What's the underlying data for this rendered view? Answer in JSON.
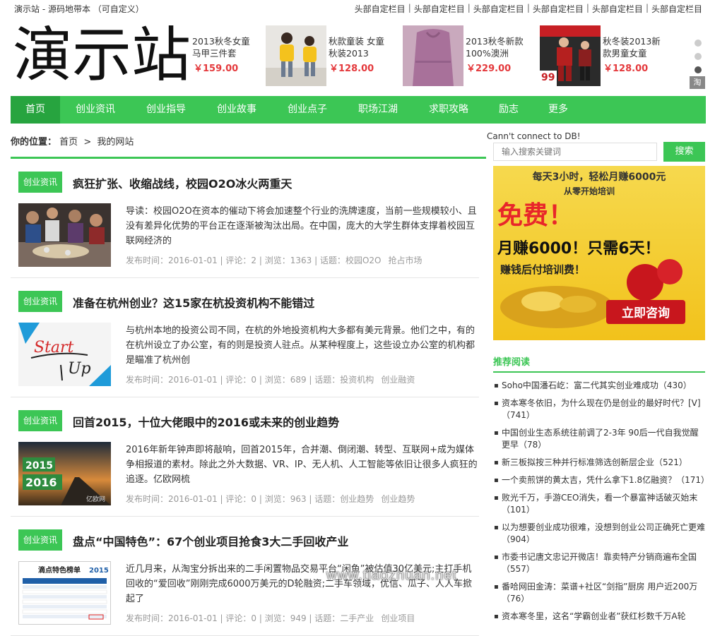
{
  "topbar": {
    "site_desc": "演示站 - 源码地带本 （可自定义）",
    "links": [
      "头部自定栏目",
      "头部自定栏目",
      "头部自定栏目",
      "头部自定栏目",
      "头部自定栏目",
      "头部自定栏目"
    ]
  },
  "logo": "演示站",
  "products": [
    {
      "title": "2013秋冬女童马甲三件套",
      "price": "￥159.00"
    },
    {
      "title": "秋款童装 女童 秋装2013",
      "price": "￥128.00"
    },
    {
      "title": "2013秋冬新款 100%澳洲",
      "price": "￥229.00"
    },
    {
      "title": "秋冬装2013新款男童女童",
      "price": "￥128.00"
    }
  ],
  "product_badge": "99",
  "taobao_badge": "淘",
  "nav": [
    "首页",
    "创业资讯",
    "创业指导",
    "创业故事",
    "创业点子",
    "职场江湖",
    "求职攻略",
    "励志",
    "更多"
  ],
  "breadcrumb": {
    "label": "你的位置：",
    "home": "首页",
    "sep": ">",
    "current": "我的网站"
  },
  "articles": [
    {
      "tag": "创业资讯",
      "title": "疯狂扩张、收缩战线，校园O2O冰火两重天",
      "summary": "导读：校园O2O在资本的催动下将会加速整个行业的洗牌速度，当前一些规模较小、且没有差异化优势的平台正在逐渐被淘汰出局。在中国，庞大的大学生群体支撑着校园互联网经济的",
      "meta": "发布时间：2016-01-01 | 评论：2 | 浏览：1363 | 话题：",
      "keywords": [
        "校园O2O",
        "抢占市场"
      ]
    },
    {
      "tag": "创业资讯",
      "title": "准备在杭州创业？这15家在杭投资机构不能错过",
      "summary": "与杭州本地的投资公司不同，在杭的外地投资机构大多都有美元背景。他们之中，有的在杭州设立了办公室，有的则是投资人驻点。从某种程度上，这些设立办公室的机构都是瞄准了杭州创",
      "meta": "发布时间：2016-01-01 | 评论：0 | 浏览：689 | 话题：",
      "keywords": [
        "投资机构",
        "创业融资"
      ],
      "thumb_text": [
        "Start",
        "Up"
      ]
    },
    {
      "tag": "创业资讯",
      "title": "回首2015，十位大佬眼中的2016或未来的创业趋势",
      "summary": "2016年新年钟声即将敲响，回首2015年，合并潮、倒闭潮、转型、互联网+成为媒体争相报道的素材。除此之外大数据、VR、IP、无人机、人工智能等依旧让很多人疯狂的追逐。亿欧网梳",
      "meta": "发布时间：2016-01-01 | 评论：0 | 浏览：963 | 话题：",
      "keywords": [
        "创业趋势",
        "创业趋势"
      ],
      "thumb_text": [
        "2015",
        "2016",
        "亿欧网"
      ]
    },
    {
      "tag": "创业资讯",
      "title": "盘点“中国特色”：67个创业项目抢食3大二手回收产业",
      "summary": "近几月来，从淘宝分拆出来的二手闲置物品交易平台“闲鱼”被估值30亿美元;主打手机回收的“爱回收”刚刚完成6000万美元的D轮融资;二手车领域，优信、瓜子、人人车掀起了",
      "meta": "发布时间：2016-01-01 | 评论：0 | 浏览：949 | 话题：",
      "keywords": [
        "二手产业",
        "创业项目"
      ],
      "thumb_text": [
        "滴点特色榜单",
        "2015"
      ]
    }
  ],
  "sidebar": {
    "db_msg": "Cann't connect to DB!",
    "search_placeholder": "输入搜索关键词",
    "search_button": "搜索",
    "ad": {
      "line1": "每天3小时，轻松月赚6000元",
      "line2": "从零开始培训",
      "line3": "免费！",
      "line4": "月赚6000！只需6天！",
      "line5": "赚钱后付培训费！",
      "button": "立即咨询"
    },
    "rec_title": "推荐阅读",
    "rec_items": [
      "Soho中国潘石屹：富二代其实创业难成功（430）",
      "资本寒冬依旧，为什么现在仍是创业的最好时代？[V]（741）",
      "中国创业生态系统往前调了2-3年 90后一代自我觉醒更早（78）",
      "新三板拟按三种并行标准筛选创新层企业（521）",
      "一个卖煎饼的黄太吉，凭什么拿下1.8亿融资？（171）",
      "败光千万，手游CEO消失，看一个暴富神话破灭始末（101）",
      "以为想要创业成功很难，没想到创业公司正确死亡更难（904）",
      "市委书记唐文忠记开微店！靠卖特产分销商遍布全国（557）",
      "番哈网田金涛：菜谱+社区“剑指”厨房 用户近200万（76）",
      "资本寒冬里，这名“学霸创业者”获红杉数千万A轮"
    ]
  },
  "watermark": "www.tiaozhuan.net",
  "colors": {
    "brand": "#3cc655",
    "brand_dark": "#27a43f",
    "price": "#e4393c"
  }
}
